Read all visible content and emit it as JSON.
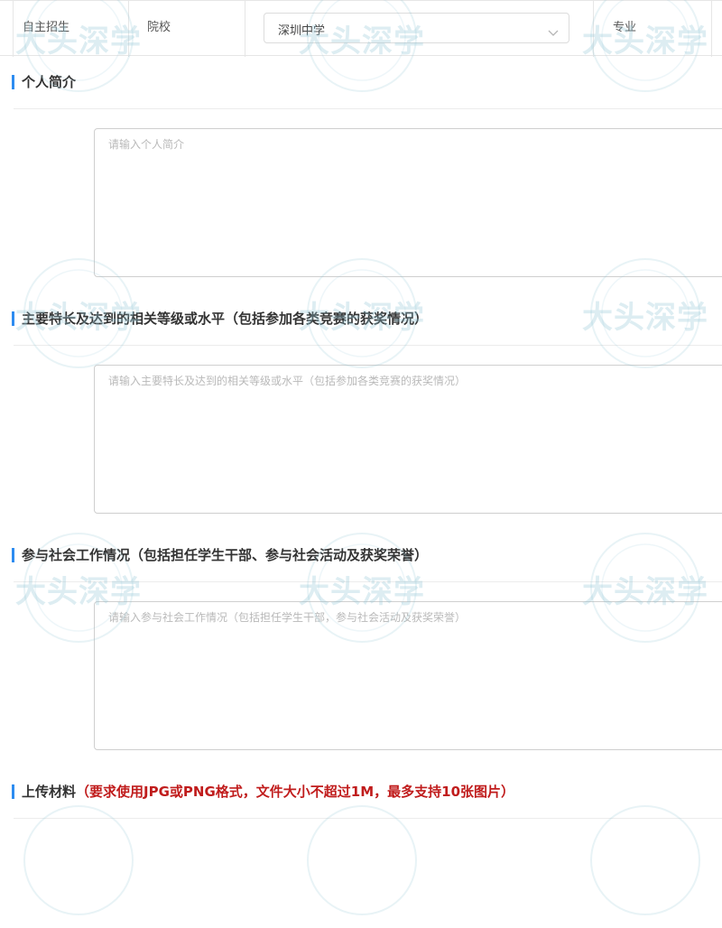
{
  "top_row": {
    "label_recruitment": "自主招生",
    "label_school": "院校",
    "school_select_value": "深圳中学",
    "label_major": "专业"
  },
  "sections": [
    {
      "title": "个人简介",
      "hint": "",
      "placeholder": "请输入个人简介"
    },
    {
      "title": "主要特长及达到的相关等级或水平（包括参加各类竞赛的获奖情况）",
      "hint": "",
      "placeholder": "请输入主要特长及达到的相关等级或水平（包括参加各类竞赛的获奖情况）"
    },
    {
      "title": "参与社会工作情况（包括担任学生干部、参与社会活动及获奖荣誉）",
      "hint": "",
      "placeholder": "请输入参与社会工作情况（包括担任学生干部，参与社会活动及获奖荣誉）"
    },
    {
      "title": "上传材料",
      "hint": "（要求使用JPG或PNG格式，文件大小不超过1M，最多支持10张图片）",
      "placeholder": ""
    }
  ],
  "watermark": {
    "text": "大头深学"
  },
  "colors": {
    "section_bar": "#2d8cf0",
    "hint_red": "#c01c1c",
    "border": "#cfcfcf",
    "placeholder": "#b9b9b9",
    "watermark": "#96c8d7"
  },
  "icons": {
    "select_arrow": "chevron-down-icon"
  }
}
